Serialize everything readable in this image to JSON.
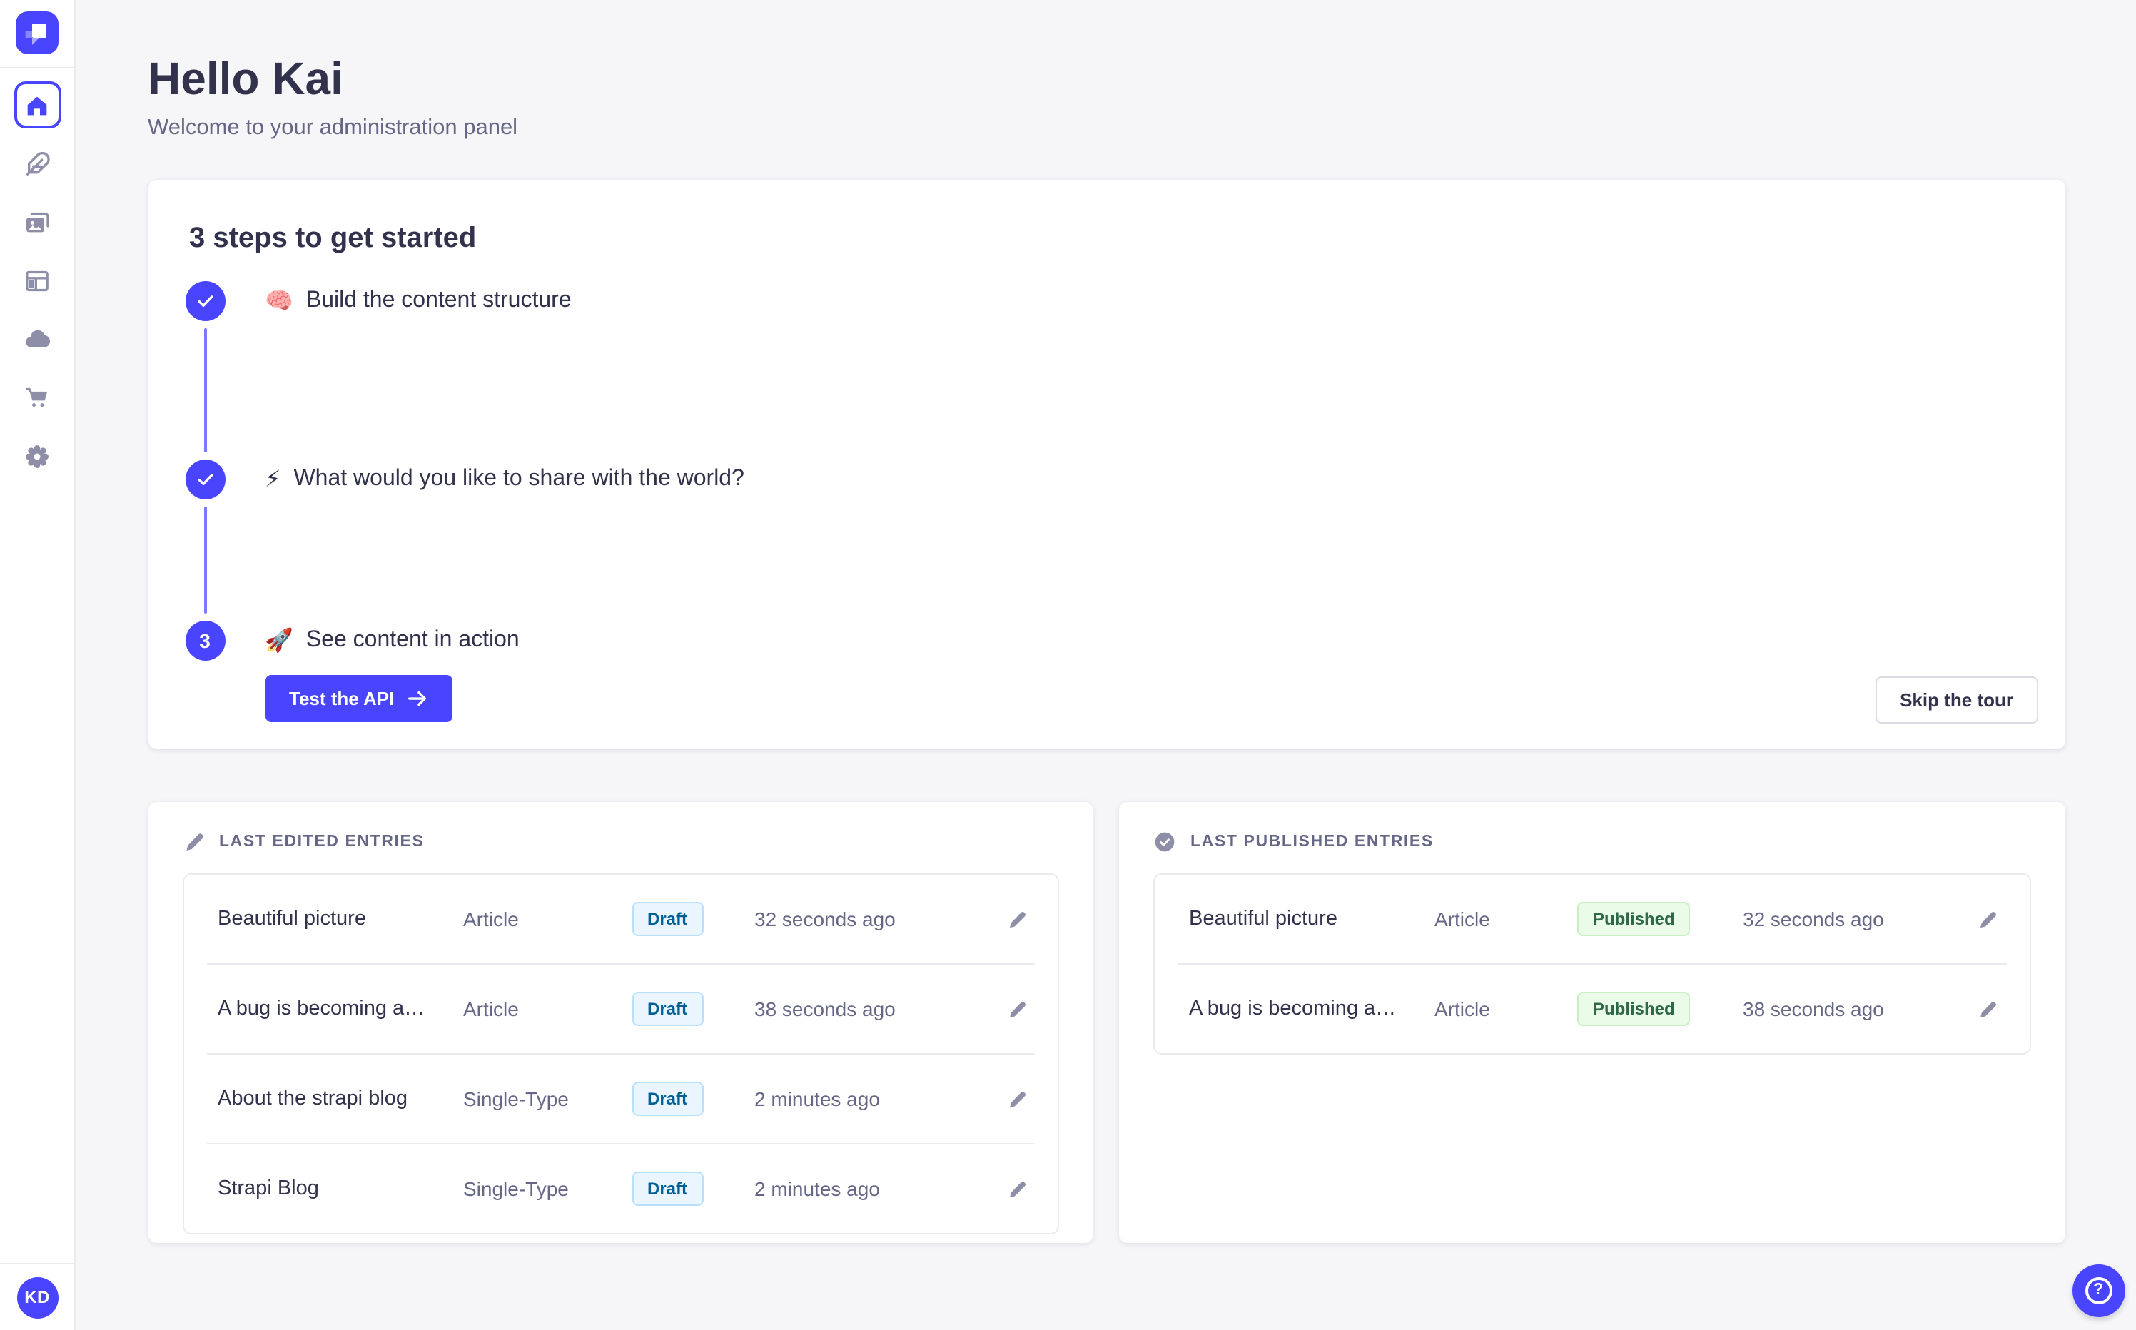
{
  "app": {
    "name": "Strapi administration panel"
  },
  "colors": {
    "primary": "#4945ff",
    "background": "#f6f6f9",
    "surface": "#ffffff",
    "text": "#32324d",
    "text_subtle": "#666687",
    "icon_inactive": "#8e8ea9",
    "border": "#eaeaef",
    "connector_line": "#7b79ff",
    "draft_bg": "#eaf5ff",
    "draft_border": "#b8e1ff",
    "draft_text": "#006096",
    "published_bg": "#eafbe7",
    "published_border": "#c6f0c2",
    "published_text": "#2f6846"
  },
  "sidebar": {
    "logo_icon": "strapi-logo",
    "items": [
      {
        "icon": "home-icon",
        "active": true
      },
      {
        "icon": "feather-icon",
        "active": false
      },
      {
        "icon": "images-icon",
        "active": false
      },
      {
        "icon": "layout-icon",
        "active": false
      },
      {
        "icon": "cloud-icon",
        "active": false
      },
      {
        "icon": "cart-icon",
        "active": false
      },
      {
        "icon": "gear-icon",
        "active": false
      }
    ],
    "avatar_initials": "KD"
  },
  "header": {
    "title": "Hello Kai",
    "subtitle": "Welcome to your administration panel"
  },
  "onboarding": {
    "title": "3 steps to get started",
    "steps": [
      {
        "state": "done",
        "icon": "check-icon",
        "emoji": "🧠",
        "label": "Build the content structure"
      },
      {
        "state": "done",
        "icon": "check-icon",
        "emoji": "⚡",
        "label": "What would you like to share with the world?"
      },
      {
        "state": "active",
        "number": "3",
        "emoji": "🚀",
        "label": "See content in action",
        "cta_label": "Test the API"
      }
    ],
    "skip_label": "Skip the tour"
  },
  "panels": {
    "edited": {
      "title": "LAST EDITED ENTRIES",
      "icon": "pencil-icon",
      "rows": [
        {
          "title": "Beautiful picture",
          "type": "Article",
          "status": "Draft",
          "time": "32 seconds ago"
        },
        {
          "title": "A bug is becoming a…",
          "type": "Article",
          "status": "Draft",
          "time": "38 seconds ago"
        },
        {
          "title": "About the strapi blog",
          "type": "Single-Type",
          "status": "Draft",
          "time": "2 minutes ago"
        },
        {
          "title": "Strapi Blog",
          "type": "Single-Type",
          "status": "Draft",
          "time": "2 minutes ago"
        }
      ]
    },
    "published": {
      "title": "LAST PUBLISHED ENTRIES",
      "icon": "check-circle-icon",
      "rows": [
        {
          "title": "Beautiful picture",
          "type": "Article",
          "status": "Published",
          "time": "32 seconds ago"
        },
        {
          "title": "A bug is becoming a…",
          "type": "Article",
          "status": "Published",
          "time": "38 seconds ago"
        }
      ]
    }
  },
  "help": {
    "icon": "question-mark-icon",
    "label": "?"
  }
}
